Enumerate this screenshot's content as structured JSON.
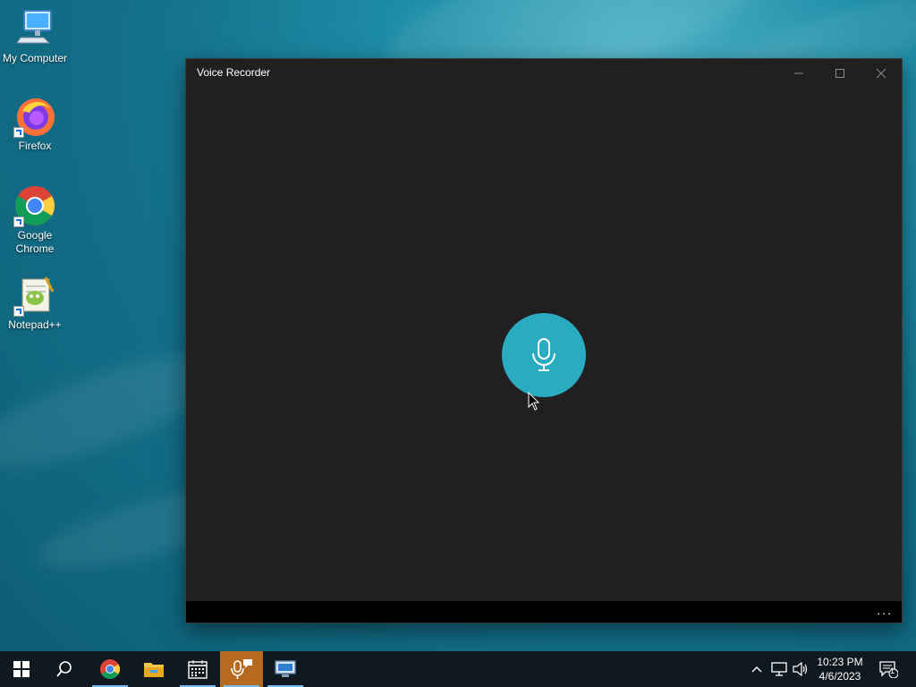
{
  "desktop": {
    "icons": [
      {
        "label": "My Computer",
        "icon": "monitor-icon"
      },
      {
        "label": "Firefox",
        "icon": "firefox-icon"
      },
      {
        "label": "Google Chrome",
        "icon": "chrome-icon"
      },
      {
        "label": "Notepad++",
        "icon": "notepad-plus-plus-icon"
      }
    ]
  },
  "window": {
    "title": "Voice Recorder",
    "controls": [
      "minimize-icon",
      "maximize-icon",
      "close-icon"
    ],
    "record_button_icon": "microphone-icon",
    "more_label": "..."
  },
  "taskbar": {
    "items": [
      "windows-start-icon",
      "search-icon",
      "chrome-icon",
      "file-explorer-icon",
      "calendar-icon",
      "voice-recorder-icon",
      "remote-desktop-icon"
    ],
    "active_item": "voice-recorder-icon",
    "clock": {
      "time": "10:23 PM",
      "date": "4/6/2023"
    },
    "notification_count": "1"
  },
  "colors": {
    "accent": "#2aabbf",
    "window_bg": "#202020",
    "taskbar_bg": "#101820",
    "active_task": "#b56a1f"
  }
}
